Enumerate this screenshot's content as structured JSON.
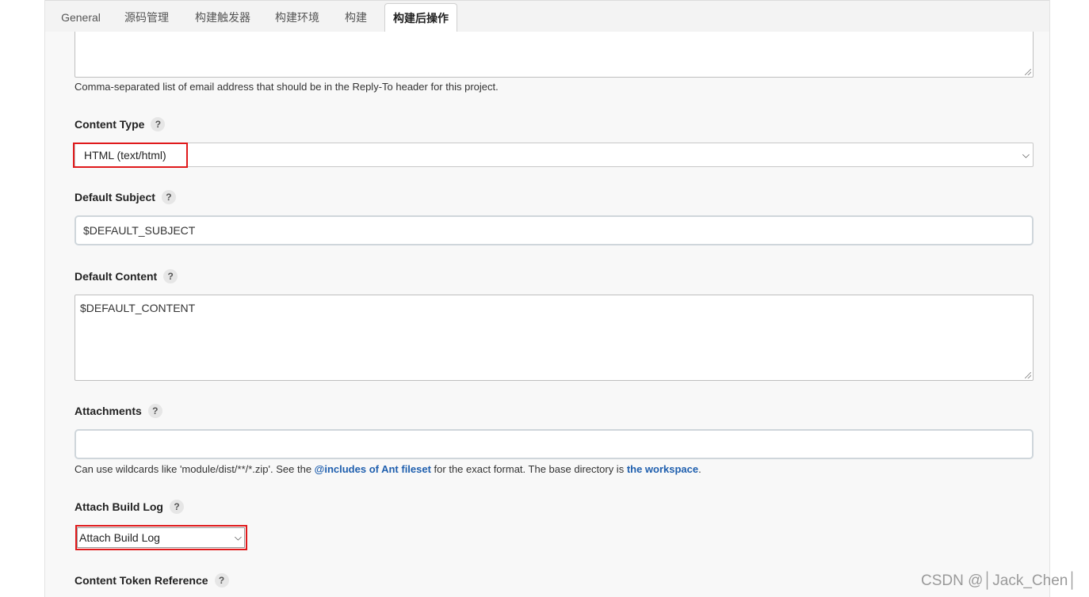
{
  "tabs": [
    {
      "label": "General"
    },
    {
      "label": "源码管理"
    },
    {
      "label": "构建触发器"
    },
    {
      "label": "构建环境"
    },
    {
      "label": "构建"
    },
    {
      "label": "构建后操作"
    }
  ],
  "reply_to": {
    "value": "",
    "help": "Comma-separated list of email address that should be in the Reply-To header for this project."
  },
  "content_type": {
    "label": "Content Type",
    "help_icon": "?",
    "selected": "HTML (text/html)"
  },
  "default_subject": {
    "label": "Default Subject",
    "help_icon": "?",
    "value": "$DEFAULT_SUBJECT"
  },
  "default_content": {
    "label": "Default Content",
    "help_icon": "?",
    "value": "$DEFAULT_CONTENT"
  },
  "attachments": {
    "label": "Attachments",
    "help_icon": "?",
    "value": "",
    "help_prefix": "Can use wildcards like 'module/dist/**/*.zip'. See the ",
    "help_link1": "@includes of Ant fileset",
    "help_middle": " for the exact format. The base directory is ",
    "help_link2": "the workspace",
    "help_suffix": "."
  },
  "attach_build_log": {
    "label": "Attach Build Log",
    "help_icon": "?",
    "selected": "Attach Build Log"
  },
  "content_token": {
    "label": "Content Token Reference",
    "help_icon": "?"
  },
  "watermark": "CSDN @│Jack_Chen│",
  "colors": {
    "highlight": "#e0191b",
    "link": "#1f5fae",
    "panel_bg": "#f8f8f8"
  }
}
